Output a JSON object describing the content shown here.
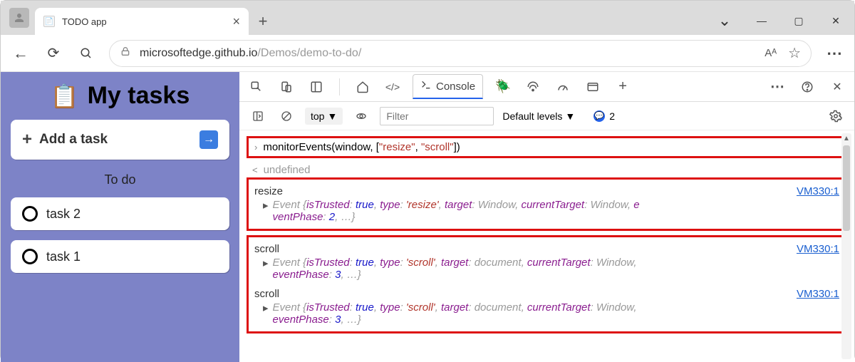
{
  "titlebar": {
    "tab_title": "TODO app",
    "close_glyph": "×",
    "newtab_glyph": "+",
    "chevron": "⌄",
    "min": "—",
    "max": "▢",
    "winclose": "✕"
  },
  "addrbar": {
    "back": "←",
    "reload": "⟳",
    "search": "🔍",
    "lock": "🔒",
    "url_host": "microsoftedge.github.io",
    "url_path": "/Demos/demo-to-do/",
    "read_aloud": "Aᴬ",
    "star": "☆",
    "more": "⋯"
  },
  "sidebar": {
    "clipboard": "📋",
    "title": "My tasks",
    "add_plus": "+",
    "add_label": "Add a task",
    "go": "→",
    "section": "To do",
    "tasks": [
      "task 2",
      "task 1"
    ]
  },
  "devtools": {
    "console_label": "Console",
    "context": "top",
    "filter_placeholder": "Filter",
    "levels": "Default levels",
    "issues": "2",
    "more": "⋯"
  },
  "console": {
    "input": {
      "fn": "monitorEvents",
      "open": "(window, [",
      "s1": "\"resize\"",
      "comma": ", ",
      "s2": "\"scroll\"",
      "close": "])"
    },
    "result_chev": "<",
    "result": "undefined",
    "source": "VM330:1",
    "events": [
      {
        "name": "resize",
        "detail": "Event {isTrusted: true, type: 'resize', target: Window, currentTarget: Window, eventPhase: 2, …}"
      },
      {
        "name": "scroll",
        "detail": "Event {isTrusted: true, type: 'scroll', target: document, currentTarget: Window, eventPhase: 3, …}"
      },
      {
        "name": "scroll",
        "detail": "Event {isTrusted: true, type: 'scroll', target: document, currentTarget: Window, eventPhase: 3, …}"
      }
    ]
  }
}
